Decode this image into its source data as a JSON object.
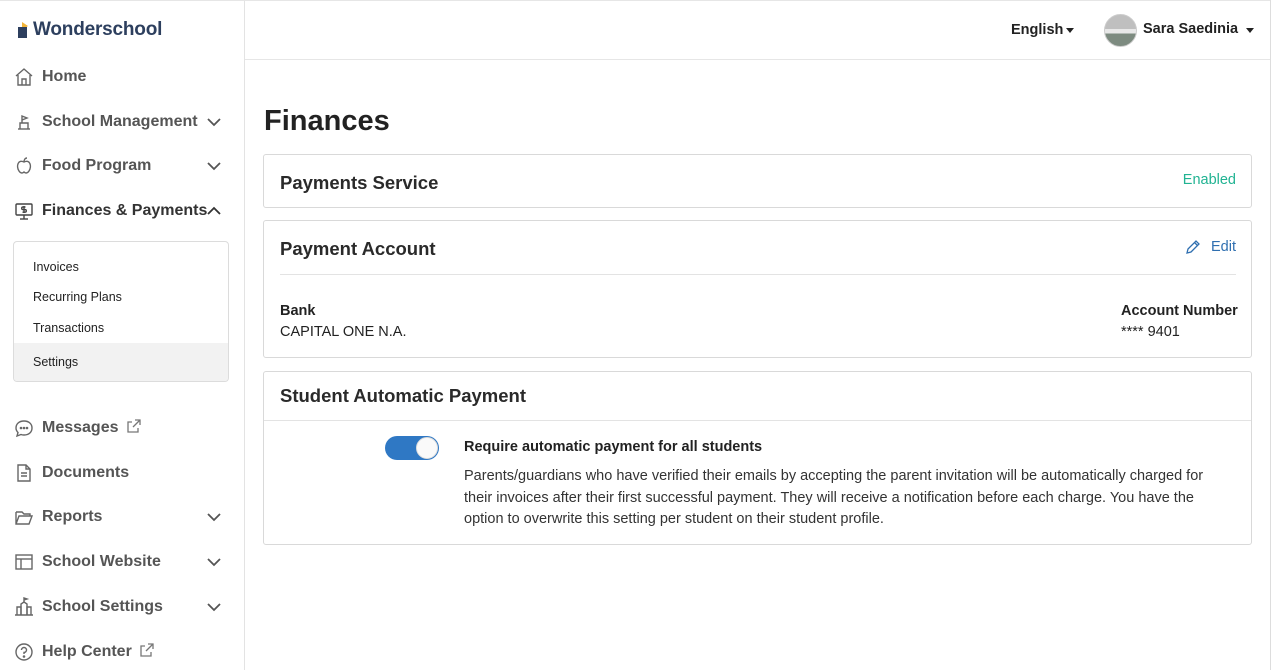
{
  "brand": {
    "name": "Wonderschool"
  },
  "sidebar": {
    "items": [
      {
        "label": "Home"
      },
      {
        "label": "School Management"
      },
      {
        "label": "Food Program"
      },
      {
        "label": "Finances & Payments"
      },
      {
        "label": "Messages"
      },
      {
        "label": "Documents"
      },
      {
        "label": "Reports"
      },
      {
        "label": "School Website"
      },
      {
        "label": "School Settings"
      },
      {
        "label": "Help Center"
      }
    ],
    "finances_submenu": [
      {
        "label": "Invoices"
      },
      {
        "label": "Recurring Plans"
      },
      {
        "label": "Transactions"
      },
      {
        "label": "Settings",
        "active": true
      }
    ]
  },
  "header": {
    "language": "English",
    "user_name": "Sara Saedinia"
  },
  "main": {
    "title": "Finances",
    "payments_service": {
      "title": "Payments Service",
      "status": "Enabled"
    },
    "payment_account": {
      "title": "Payment Account",
      "edit_label": "Edit",
      "bank_label": "Bank",
      "bank_value": "CAPITAL ONE N.A.",
      "account_label": "Account Number",
      "account_value": "**** 9401"
    },
    "auto_payment": {
      "title": "Student Automatic Payment",
      "toggle_on": true,
      "option_title": "Require automatic payment for all students",
      "option_description": "Parents/guardians who have verified their emails by accepting the parent invitation will be automatically charged for their invoices after their first successful payment. They will receive a notification before each charge. You have the option to overwrite this setting per student on their student profile."
    }
  },
  "colors": {
    "enabled": "#21b392",
    "link": "#2f6fb0",
    "toggle": "#2f78c4",
    "brand_text": "#2d3f5e"
  }
}
